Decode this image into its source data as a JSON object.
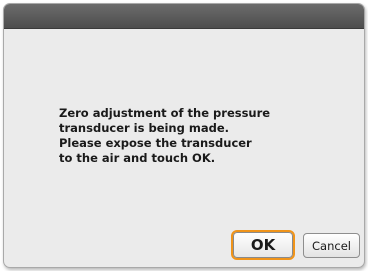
{
  "dialog": {
    "message_lines": [
      "Zero adjustment of the pressure",
      "transducer is being made.",
      "Please expose the transducer",
      "to the air and touch OK."
    ]
  },
  "buttons": {
    "ok_label": "OK",
    "cancel_label": "Cancel"
  },
  "colors": {
    "titlebar": "#555555",
    "dialog_background": "#ebebeb",
    "focus_outline": "#f0941a"
  }
}
